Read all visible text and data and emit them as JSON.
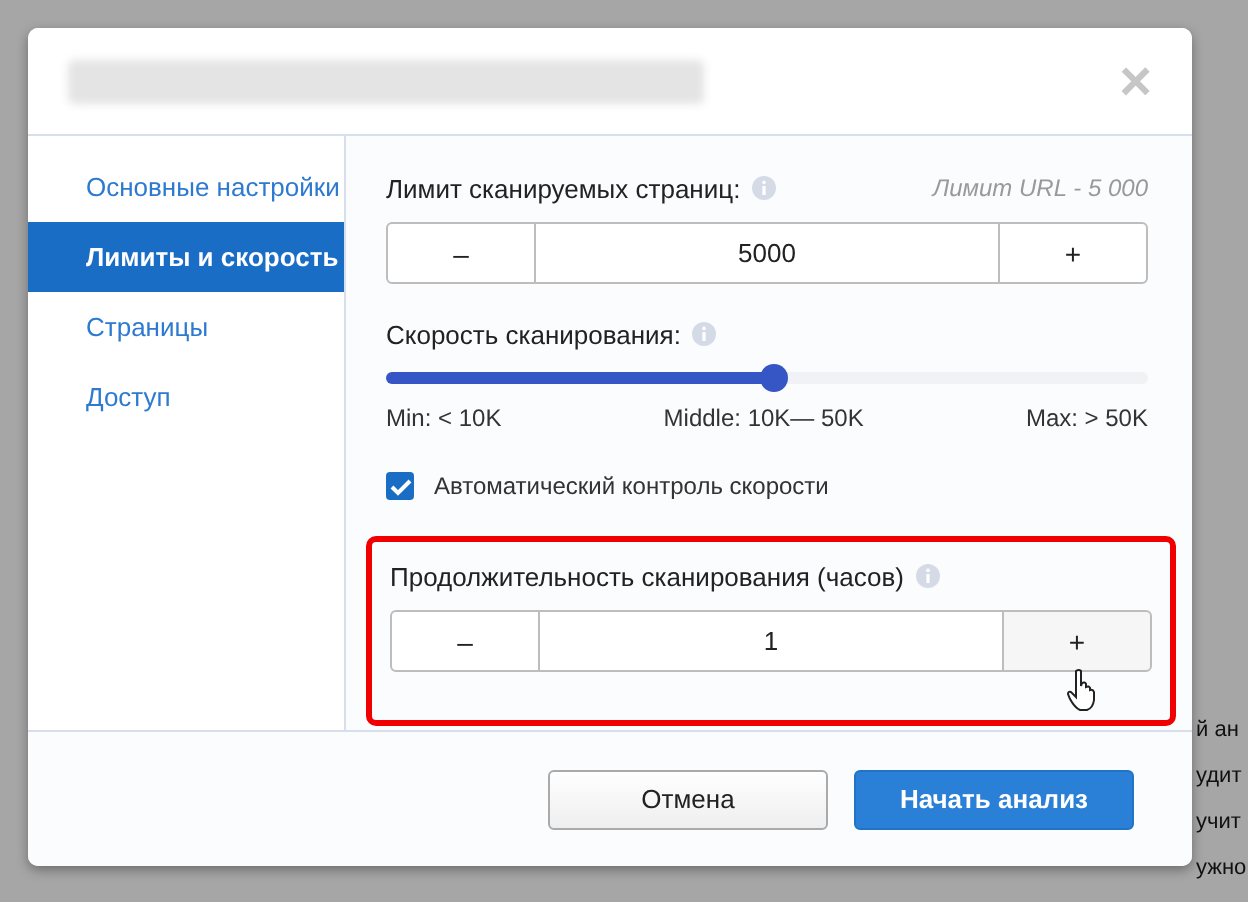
{
  "dialog": {
    "close_icon": "×"
  },
  "sidebar": {
    "items": [
      {
        "label": "Основные настройки",
        "selected": false
      },
      {
        "label": "Лимиты и скорость",
        "selected": true
      },
      {
        "label": "Страницы",
        "selected": false
      },
      {
        "label": "Доступ",
        "selected": false
      }
    ]
  },
  "page_limit": {
    "label": "Лимит сканируемых страниц:",
    "note": "Лимит URL - 5 000",
    "minus": "–",
    "value": "5000",
    "plus": "+"
  },
  "speed": {
    "label": "Скорость сканирования:",
    "level": 0.51,
    "marks": [
      "Min: < 10K",
      "Middle: 10K— 50K",
      "Max: > 50K"
    ]
  },
  "auto_speed": {
    "label": "Автоматический контроль скорости",
    "checked": true
  },
  "duration": {
    "label": "Продолжительность сканирования (часов)",
    "highlighted": true,
    "minus": "–",
    "value": "1",
    "plus": "+"
  },
  "buttons": [
    {
      "label": "Отмена",
      "kind": "secondary"
    },
    {
      "label": "Начать анализ",
      "kind": "primary"
    }
  ],
  "background_text": [
    "й ан",
    "удит",
    "учит",
    "ужно"
  ]
}
